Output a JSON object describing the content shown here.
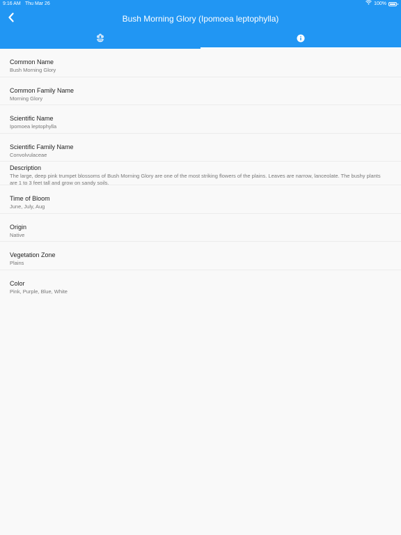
{
  "status_bar": {
    "time": "9:16 AM",
    "date": "Thu Mar 26",
    "battery": "100%"
  },
  "header": {
    "title": "Bush Morning Glory (Ipomoea leptophylla)",
    "back_icon": "chevron-left-icon",
    "tabs": [
      {
        "icon": "flower-icon",
        "selected": false
      },
      {
        "icon": "info-icon",
        "selected": true
      }
    ]
  },
  "details": [
    {
      "label": "Common Name",
      "value": "Bush Morning Glory"
    },
    {
      "label": "Common Family Name",
      "value": "Morning Glory"
    },
    {
      "label": "Scientific Name",
      "value": "Ipomoea leptophylla"
    },
    {
      "label": "Scientific Family Name",
      "value": "Convolvulaceae"
    },
    {
      "label": "Description",
      "value": "The large, deep pink trumpet blossoms of Bush Morning Glory are one of the most striking flowers of the plains. Leaves are narrow, lanceolate. The bushy plants are 1 to 3 feet tall and grow on sandy soils."
    },
    {
      "label": "Time of Bloom",
      "value": "June, July, Aug"
    },
    {
      "label": "Origin",
      "value": "Native"
    },
    {
      "label": "Vegetation Zone",
      "value": "Plains"
    },
    {
      "label": "Color",
      "value": "Pink, Purple, Blue, White"
    }
  ],
  "colors": {
    "app_bar": "#2196f3",
    "background": "#f9f9f9",
    "label": "#222222",
    "value": "#777777",
    "divider": "#ececec"
  }
}
